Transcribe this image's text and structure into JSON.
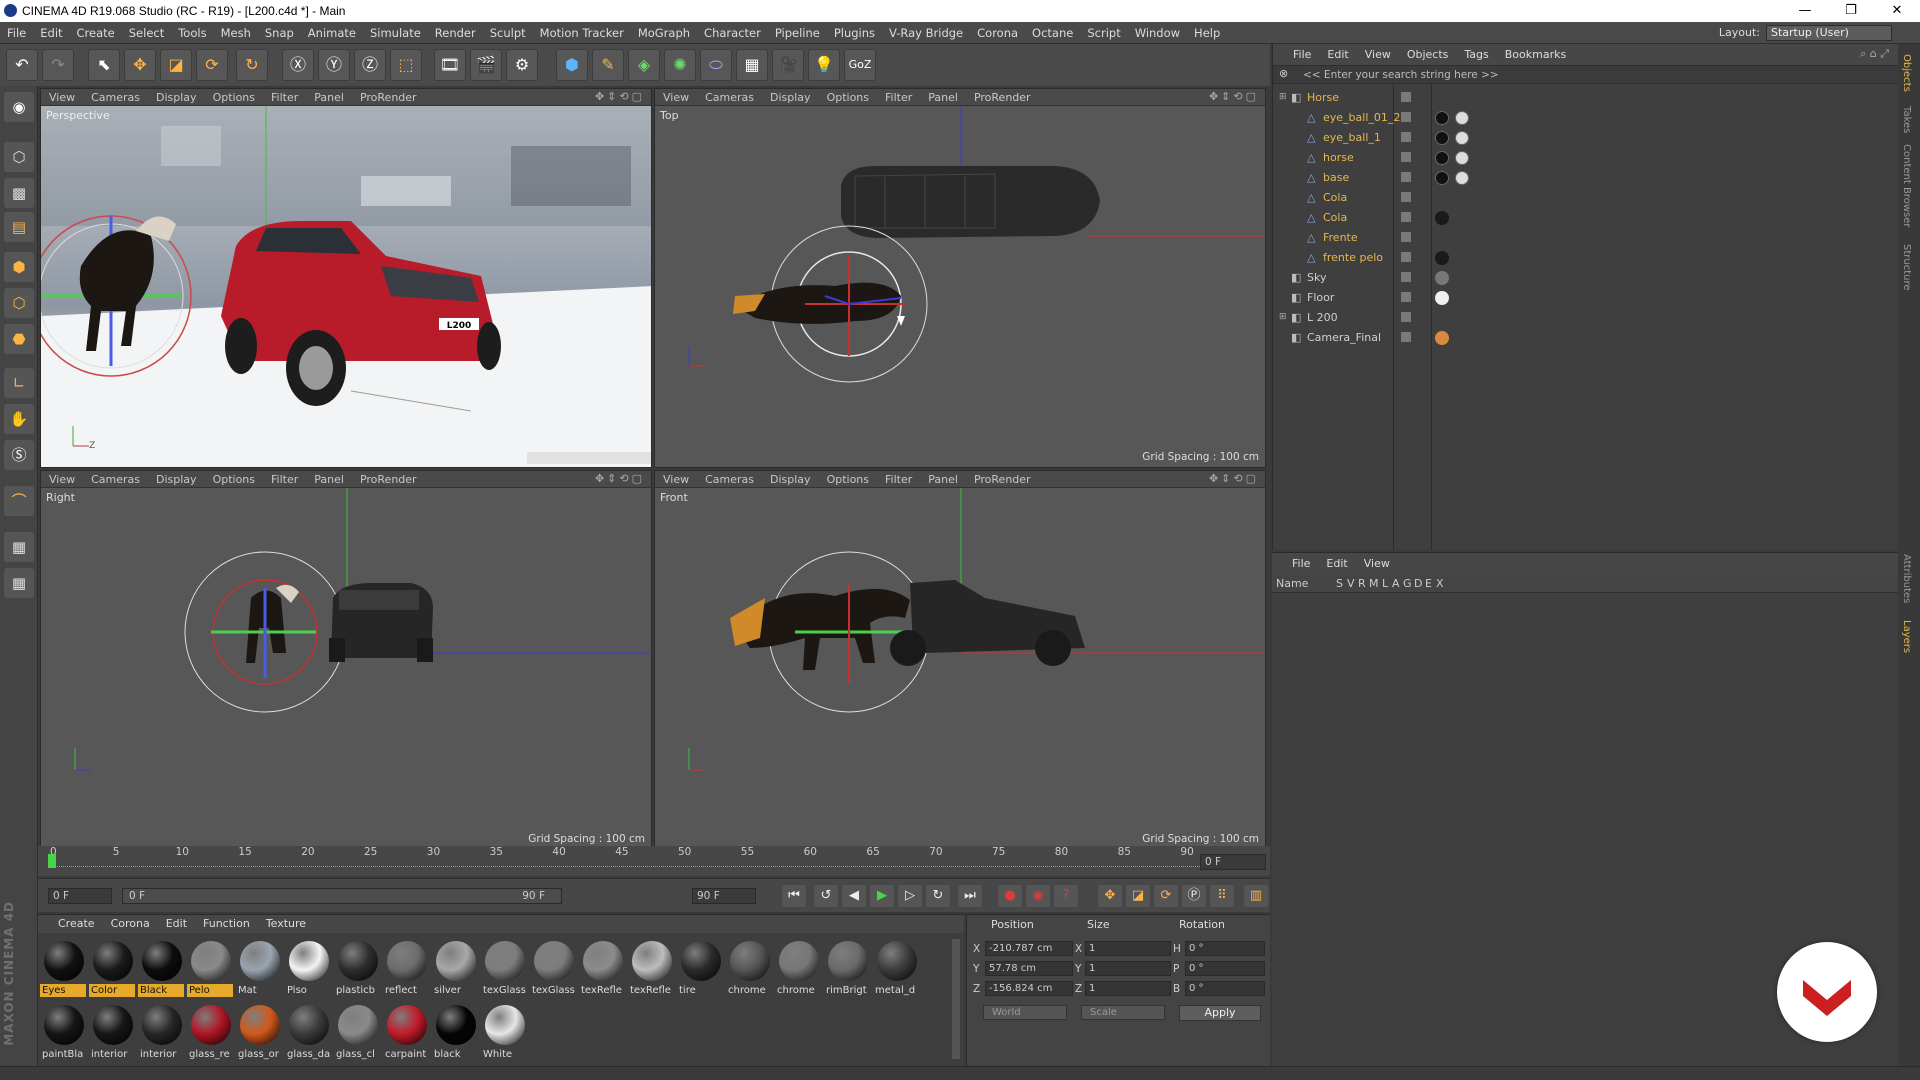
{
  "window": {
    "title": "CINEMA 4D R19.068 Studio (RC - R19) - [L200.c4d *] - Main",
    "minimize": "—",
    "maximize": "❐",
    "close": "✕"
  },
  "menubar": {
    "items": [
      "File",
      "Edit",
      "Create",
      "Select",
      "Tools",
      "Mesh",
      "Snap",
      "Animate",
      "Simulate",
      "Render",
      "Sculpt",
      "Motion Tracker",
      "MoGraph",
      "Character",
      "Pipeline",
      "Plugins",
      "V-Ray Bridge",
      "Corona",
      "Octane",
      "Script",
      "Window",
      "Help"
    ],
    "layout_label": "Layout:",
    "layout_value": "Startup (User)"
  },
  "viewports": {
    "menu": [
      "View",
      "Cameras",
      "Display",
      "Options",
      "Filter",
      "Panel",
      "ProRender"
    ],
    "perspective": {
      "name": "Perspective"
    },
    "top": {
      "name": "Top",
      "grid": "Grid Spacing : 100 cm"
    },
    "right": {
      "name": "Right",
      "grid": "Grid Spacing : 100 cm"
    },
    "front": {
      "name": "Front",
      "grid": "Grid Spacing : 100 cm"
    },
    "truck_plate": "L200"
  },
  "object_manager": {
    "menu": [
      "File",
      "Edit",
      "View",
      "Objects",
      "Tags",
      "Bookmarks"
    ],
    "search_placeholder": "<< Enter your search string here >>",
    "objects": [
      {
        "name": "Horse",
        "level": 0,
        "color": "#e6b84c"
      },
      {
        "name": "eye_ball_01_2",
        "level": 1,
        "color": "#e6b84c"
      },
      {
        "name": "eye_ball_1",
        "level": 1,
        "color": "#e6b84c"
      },
      {
        "name": "horse",
        "level": 1,
        "color": "#e6b84c"
      },
      {
        "name": "base",
        "level": 1,
        "color": "#e6b84c"
      },
      {
        "name": "Cola",
        "level": 1,
        "color": "#e6b84c"
      },
      {
        "name": "Cola",
        "level": 1,
        "color": "#e6b84c"
      },
      {
        "name": "Frente",
        "level": 1,
        "color": "#e6b84c"
      },
      {
        "name": "frente pelo",
        "level": 1,
        "color": "#e6b84c"
      },
      {
        "name": "Sky",
        "level": 0,
        "color": "#cfcfcf"
      },
      {
        "name": "Floor",
        "level": 0,
        "color": "#cfcfcf"
      },
      {
        "name": "L 200",
        "level": 0,
        "color": "#cfcfcf"
      },
      {
        "name": "Camera_Final",
        "level": 0,
        "color": "#cfcfcf"
      }
    ]
  },
  "layer_manager": {
    "menu": [
      "File",
      "Edit",
      "View"
    ],
    "col_name": "Name",
    "cols": [
      "S",
      "V",
      "R",
      "M",
      "L",
      "A",
      "G",
      "D",
      "E",
      "X"
    ]
  },
  "right_tabs": [
    "Objects",
    "Takes",
    "Content Browser",
    "Structure",
    "Attributes",
    "Layers"
  ],
  "timeline": {
    "ticks": [
      "0",
      "5",
      "10",
      "15",
      "20",
      "25",
      "30",
      "35",
      "40",
      "45",
      "50",
      "55",
      "60",
      "65",
      "70",
      "75",
      "80",
      "85",
      "90"
    ],
    "current_frame": "0 F",
    "start": "0 F",
    "range_start": "0 F",
    "range_end": "90 F",
    "end": "90 F"
  },
  "material_manager": {
    "menu": [
      "Create",
      "Corona",
      "Edit",
      "Function",
      "Texture"
    ],
    "row1": [
      {
        "label": "Eyes",
        "color": "#111111",
        "selected": true
      },
      {
        "label": "Color",
        "color": "#1a1a1a",
        "selected": true
      },
      {
        "label": "Black",
        "color": "#0c0c0c",
        "selected": true
      },
      {
        "label": "Pelo",
        "color": "#8a8a8a",
        "selected": true
      },
      {
        "label": "Mat",
        "color": "#9aa4b0",
        "selected": false
      },
      {
        "label": "Piso",
        "color": "#f4f4f4",
        "selected": false
      },
      {
        "label": "plasticb",
        "color": "#2e2e2e",
        "selected": false
      },
      {
        "label": "reflect",
        "color": "#6c6c6c",
        "selected": false
      },
      {
        "label": "silver",
        "color": "#a8a8a8",
        "selected": false
      },
      {
        "label": "texGlass",
        "color": "#7d7d7d",
        "selected": false
      },
      {
        "label": "texGlass",
        "color": "#7d7d7d",
        "selected": false
      },
      {
        "label": "texRefle",
        "color": "#8c8c8c",
        "selected": false
      },
      {
        "label": "texRefle",
        "color": "#bdbdbd",
        "selected": false
      },
      {
        "label": "tire",
        "color": "#2a2a2a",
        "selected": false
      },
      {
        "label": "chrome",
        "color": "#555555",
        "selected": false
      },
      {
        "label": "chrome",
        "color": "#777777",
        "selected": false
      },
      {
        "label": "rimBrigt",
        "color": "#6a6a6a",
        "selected": false
      },
      {
        "label": "metal_d",
        "color": "#3c3c3c",
        "selected": false
      }
    ],
    "row2": [
      {
        "label": "paintBla",
        "color": "#151515",
        "selected": false
      },
      {
        "label": "interior",
        "color": "#161616",
        "selected": false
      },
      {
        "label": "interior",
        "color": "#262626",
        "selected": false
      },
      {
        "label": "glass_re",
        "color": "#b01524",
        "selected": false
      },
      {
        "label": "glass_or",
        "color": "#d2581a",
        "selected": false
      },
      {
        "label": "glass_da",
        "color": "#3a3a3a",
        "selected": false
      },
      {
        "label": "glass_cl",
        "color": "#8a8a8a",
        "selected": false
      },
      {
        "label": "carpaint",
        "color": "#c21a28",
        "selected": false
      },
      {
        "label": "black",
        "color": "#050505",
        "selected": false
      },
      {
        "label": "White",
        "color": "#e6e6e6",
        "selected": false
      }
    ]
  },
  "coordinates": {
    "position_label": "Position",
    "size_label": "Size",
    "rotation_label": "Rotation",
    "pos": {
      "x": "-210.787 cm",
      "y": "57.78 cm",
      "z": "-156.824 cm"
    },
    "size": {
      "x": "1",
      "y": "1",
      "z": "1"
    },
    "rot": {
      "h": "0 °",
      "p": "0 °",
      "b": "0 °"
    },
    "axis_labels": {
      "x": "X",
      "y": "Y",
      "z": "Z",
      "h": "H",
      "p": "P",
      "b": "B"
    },
    "world": "World",
    "scale": "Scale",
    "apply": "Apply"
  },
  "branding": {
    "maxon": "MAXON CINEMA 4D",
    "accent": "#cc1f1f"
  }
}
